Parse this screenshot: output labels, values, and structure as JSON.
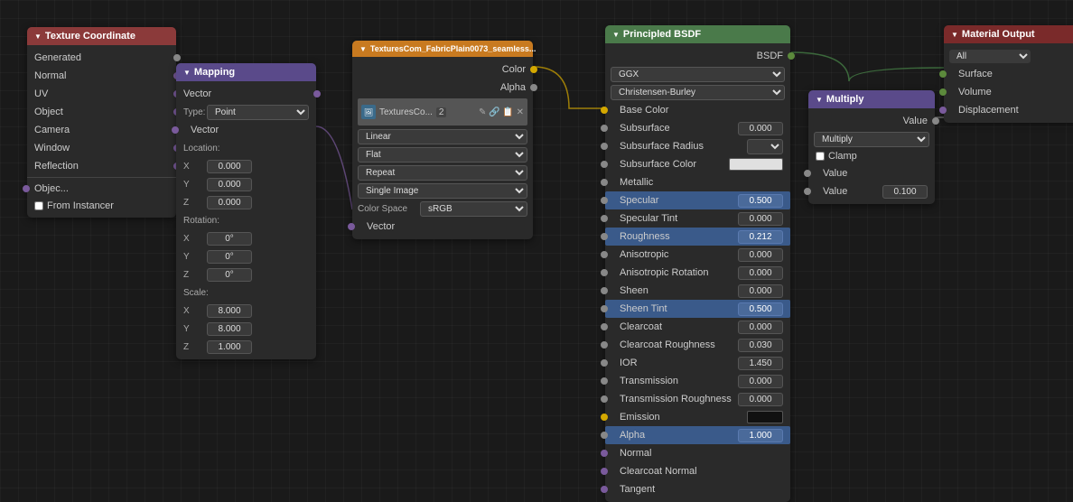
{
  "nodes": {
    "texture_coordinate": {
      "title": "Texture Coordinate",
      "outputs": [
        "Generated",
        "Normal",
        "UV",
        "Object",
        "Camera",
        "Window",
        "Reflection"
      ],
      "bottom_label": "Objec...",
      "checkbox_label": "From Instancer"
    },
    "mapping": {
      "title": "Mapping",
      "type_label": "Type:",
      "type_value": "Point",
      "vector_label": "Vector",
      "location_label": "Location:",
      "loc_x": "0.000",
      "loc_y": "0.000",
      "loc_z": "0.000",
      "rotation_label": "Rotation:",
      "rot_x": "0°",
      "rot_y": "0°",
      "rot_z": "0°",
      "scale_label": "Scale:",
      "scale_x": "8.000",
      "scale_y": "8.000",
      "scale_z": "1.000"
    },
    "image_texture": {
      "title": "TexturesCom_FabricPlain0073_seamless...",
      "color_label": "Color",
      "alpha_label": "Alpha",
      "image_name": "TexturesCo...",
      "image_num": "2",
      "interpolation": "Linear",
      "projection": "Flat",
      "repeat": "Repeat",
      "single_image": "Single Image",
      "color_space_label": "Color Space",
      "color_space_value": "sRGB",
      "vector_label": "Vector"
    },
    "principled_bsdf": {
      "title": "Principled BSDF",
      "bsdf_label": "BSDF",
      "distribution": "GGX",
      "subsurface_method": "Christensen-Burley",
      "base_color_label": "Base Color",
      "subsurface_label": "Subsurface",
      "subsurface_value": "0.000",
      "subsurface_radius_label": "Subsurface Radius",
      "subsurface_color_label": "Subsurface Color",
      "metallic_label": "Metallic",
      "specular_label": "Specular",
      "specular_value": "0.500",
      "specular_tint_label": "Specular Tint",
      "specular_tint_value": "0.000",
      "roughness_label": "Roughness",
      "roughness_value": "0.212",
      "anisotropic_label": "Anisotropic",
      "anisotropic_value": "0.000",
      "anisotropic_rotation_label": "Anisotropic Rotation",
      "anisotropic_rotation_value": "0.000",
      "sheen_label": "Sheen",
      "sheen_value": "0.000",
      "sheen_tint_label": "Sheen Tint",
      "sheen_tint_value": "0.500",
      "clearcoat_label": "Clearcoat",
      "clearcoat_value": "0.000",
      "clearcoat_roughness_label": "Clearcoat Roughness",
      "clearcoat_roughness_value": "0.030",
      "ior_label": "IOR",
      "ior_value": "1.450",
      "transmission_label": "Transmission",
      "transmission_value": "0.000",
      "transmission_roughness_label": "Transmission Roughness",
      "transmission_roughness_value": "0.000",
      "emission_label": "Emission",
      "alpha_label": "Alpha",
      "alpha_value": "1.000",
      "normal_label": "Normal",
      "clearcoat_normal_label": "Clearcoat Normal",
      "tangent_label": "Tangent"
    },
    "multiply": {
      "title": "Multiply",
      "value_label": "Value",
      "operation": "Multiply",
      "clamp_label": "Clamp",
      "value_input": "Value",
      "value_output": "Value",
      "value_num": "0.100"
    },
    "material_output": {
      "title": "Material Output",
      "all_option": "All",
      "surface_label": "Surface",
      "volume_label": "Volume",
      "displacement_label": "Displacement"
    }
  },
  "colors": {
    "bg": "#1a1a1a",
    "node_bg": "#2a2a2a",
    "header_texture_coord": "#8b3a3a",
    "header_mapping": "#5a4a8a",
    "header_image_texture": "#c87a20",
    "header_principled": "#4a7a4a",
    "header_multiply": "#5a4a8a",
    "header_material_output": "#7a2a2a",
    "highlight_blue": "#3a5a8a",
    "highlight_orange": "#8a4a20",
    "socket_yellow": "#d4a800",
    "socket_gray": "#888888",
    "socket_green": "#5c8a3c",
    "socket_purple": "#7a5a9c",
    "socket_blue": "#4472b0",
    "socket_white": "#cccccc"
  }
}
